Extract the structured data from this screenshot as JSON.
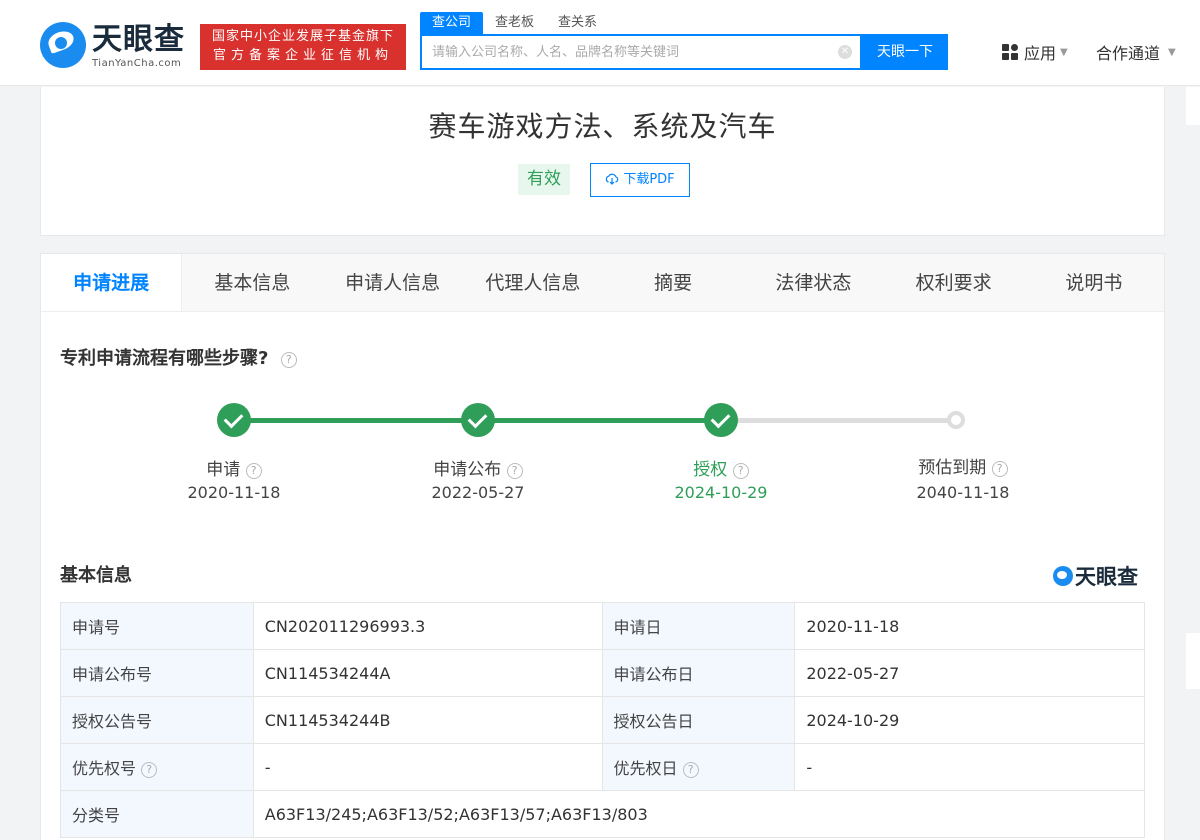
{
  "header": {
    "logo": {
      "name": "天眼查",
      "domain": "TianYanCha.com"
    },
    "gov_badge": {
      "line1": "国家中小企业发展子基金旗下",
      "line2": "官方备案企业征信机构"
    },
    "search_tabs": [
      "查公司",
      "查老板",
      "查关系"
    ],
    "search_placeholder": "请输入公司名称、人名、品牌名称等关键词",
    "search_button": "天眼一下",
    "apps_label": "应用",
    "coop_label": "合作通道"
  },
  "patent": {
    "title": "赛车游戏方法、系统及汽车",
    "status": "有效",
    "download_label": "下载PDF"
  },
  "tabs": [
    "申请进展",
    "基本信息",
    "申请人信息",
    "代理人信息",
    "摘要",
    "法律状态",
    "权利要求",
    "说明书"
  ],
  "progress": {
    "title": "专利申请流程有哪些步骤?",
    "steps": [
      {
        "label": "申请",
        "date": "2020-11-18"
      },
      {
        "label": "申请公布",
        "date": "2022-05-27"
      },
      {
        "label": "授权",
        "date": "2024-10-29"
      },
      {
        "label": "预估到期",
        "date": "2040-11-18"
      }
    ]
  },
  "basic_info": {
    "title": "基本信息",
    "brand": "天眼查",
    "rows": [
      {
        "k1": "申请号",
        "v1": "CN202011296993.3",
        "k2": "申请日",
        "v2": "2020-11-18"
      },
      {
        "k1": "申请公布号",
        "v1": "CN114534244A",
        "k2": "申请公布日",
        "v2": "2022-05-27"
      },
      {
        "k1": "授权公告号",
        "v1": "CN114534244B",
        "k2": "授权公告日",
        "v2": "2024-10-29"
      },
      {
        "k1": "优先权号",
        "v1": "-",
        "k2": "优先权日",
        "v2": "-"
      }
    ],
    "classification": {
      "k": "分类号",
      "v": "A63F13/245;A63F13/52;A63F13/57;A63F13/803"
    }
  },
  "colors": {
    "accent": "#0084ff",
    "success": "#2f9e58",
    "badge_red": "#d8312e"
  }
}
